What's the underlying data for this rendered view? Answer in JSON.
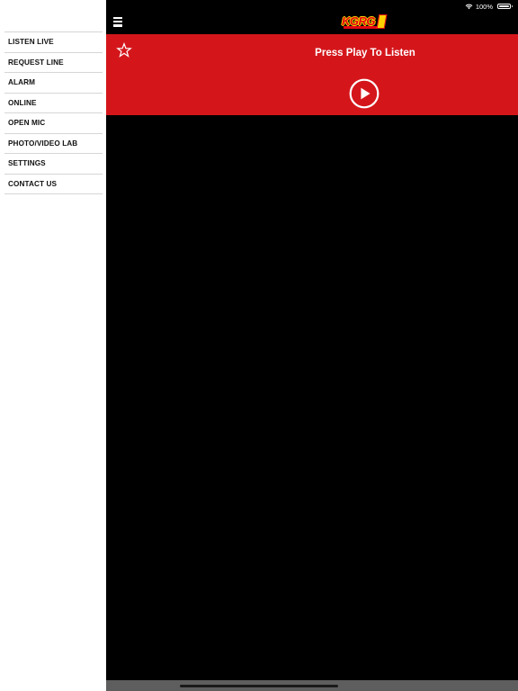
{
  "status_bar": {
    "battery": "100%"
  },
  "sidebar": {
    "items": [
      {
        "label": "LISTEN LIVE"
      },
      {
        "label": "REQUEST LINE"
      },
      {
        "label": "ALARM"
      },
      {
        "label": "ONLINE"
      },
      {
        "label": "OPEN MIC"
      },
      {
        "label": "PHOTO/VIDEO LAB"
      },
      {
        "label": "SETTINGS"
      },
      {
        "label": "CONTACT US"
      }
    ]
  },
  "header": {
    "logo_text": "KGRG"
  },
  "player": {
    "title": "Press Play To Listen"
  },
  "colors": {
    "accent": "#d4161b",
    "background": "#000000",
    "sidebar_bg": "#ffffff",
    "logo_yellow": "#ffd200"
  },
  "icons": {
    "menu": "hamburger-icon",
    "favorite": "star-icon",
    "play": "play-icon",
    "wifi": "wifi-icon",
    "battery": "battery-icon"
  }
}
